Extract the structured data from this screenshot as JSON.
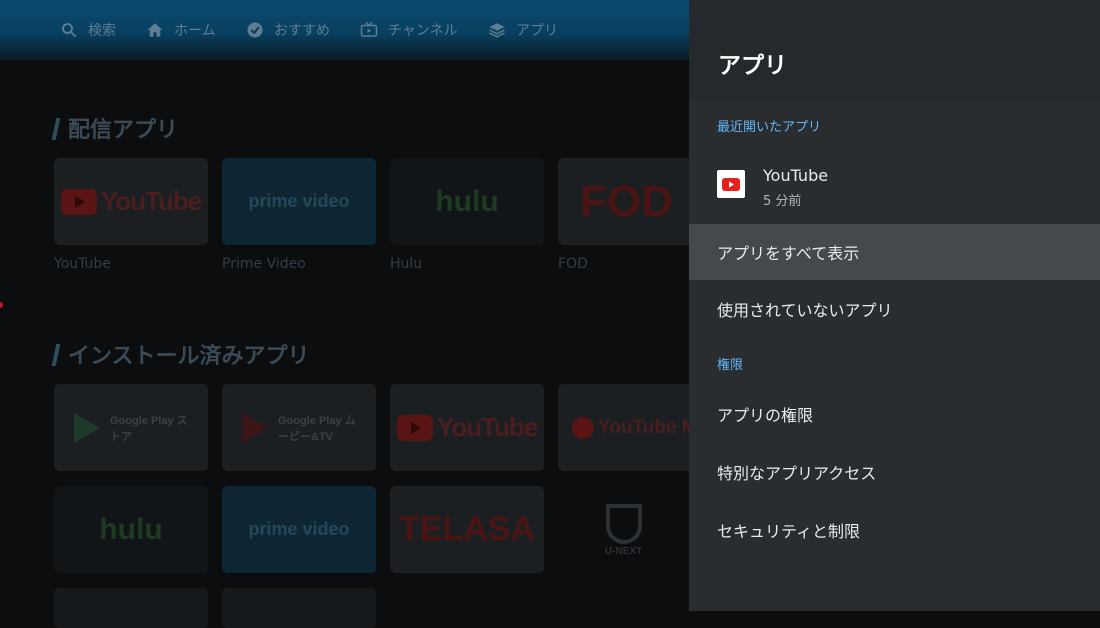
{
  "topnav": {
    "items": [
      {
        "label": "検索",
        "icon": "search-icon"
      },
      {
        "label": "ホーム",
        "icon": "home-icon"
      },
      {
        "label": "おすすめ",
        "icon": "check-badge-icon"
      },
      {
        "label": "チャンネル",
        "icon": "tv-icon"
      },
      {
        "label": "アプリ",
        "icon": "apps-stack-icon"
      }
    ]
  },
  "background": {
    "section1_title": "配信アプリ",
    "section2_title": "インストール済みアプリ",
    "row1": [
      {
        "caption": "YouTube",
        "logo": "YouTube"
      },
      {
        "caption": "Prime Video",
        "logo": "prime video"
      },
      {
        "caption": "Hulu",
        "logo": "hulu"
      },
      {
        "caption": "FOD",
        "logo": "FOD"
      }
    ],
    "row2": [
      {
        "logo": "Google Play ストア"
      },
      {
        "logo": "Google Play ムービー&TV"
      },
      {
        "logo": "YouTube"
      },
      {
        "logo": "YouTube Music"
      }
    ],
    "row3": [
      {
        "logo": "hulu"
      },
      {
        "logo": "prime video"
      },
      {
        "logo": "TELASA"
      },
      {
        "logo": "U-NEXT"
      }
    ]
  },
  "panel": {
    "title": "アプリ",
    "recent_header": "最近開いたアプリ",
    "recent_app": {
      "name": "YouTube",
      "time": "5 分前",
      "icon": "youtube-icon"
    },
    "show_all": "アプリをすべて表示",
    "unused": "使用されていないアプリ",
    "permissions_header": "権限",
    "app_permissions": "アプリの権限",
    "special_access": "特別なアプリアクセス",
    "security": "セキュリティと制限"
  },
  "colors": {
    "accent": "#64b5f6",
    "panel_bg": "#2a2d30",
    "highlight": "#46494c"
  }
}
